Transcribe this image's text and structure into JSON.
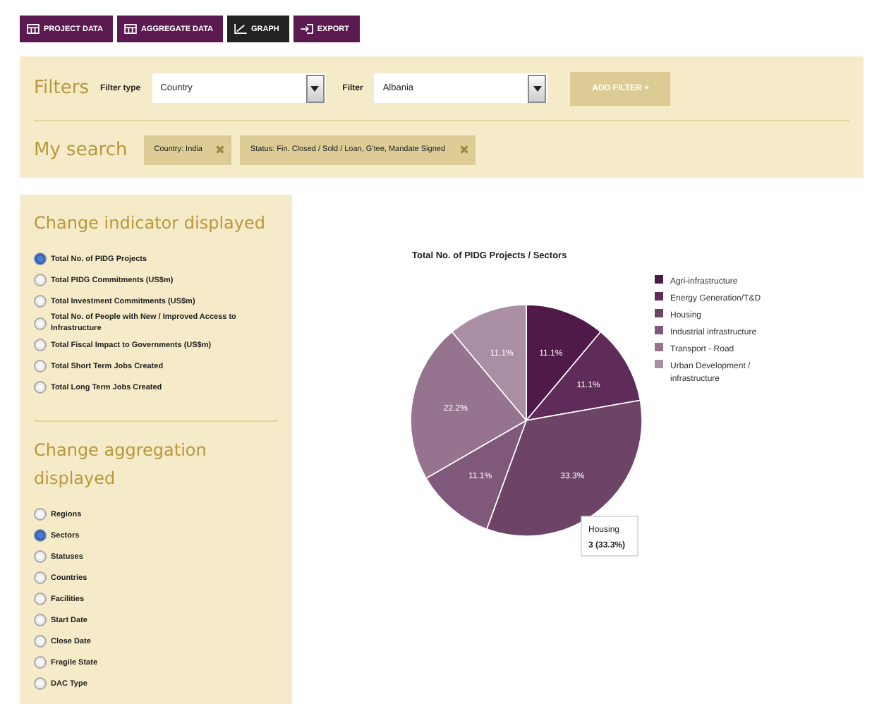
{
  "tabs": [
    {
      "label": "PROJECT DATA",
      "kind": "table",
      "selected": false
    },
    {
      "label": "AGGREGATE DATA",
      "kind": "table",
      "selected": false
    },
    {
      "label": "GRAPH",
      "kind": "chart",
      "selected": true
    },
    {
      "label": "EXPORT",
      "kind": "export",
      "selected": false
    }
  ],
  "filters": {
    "title": "Filters",
    "filter_type_label": "Filter type",
    "filter_type_value": "Country",
    "filter_label": "Filter",
    "filter_value": "Albania",
    "add_button": "ADD FILTER +"
  },
  "my_search": {
    "title": "My search",
    "tags": [
      {
        "label": "Country: India"
      },
      {
        "label": "Status: Fin. Closed / Sold / Loan, G'tee, Mandate Signed"
      }
    ]
  },
  "indicator": {
    "title": "Change indicator displayed",
    "options": [
      {
        "label": "Total No. of PIDG Projects",
        "selected": true
      },
      {
        "label": "Total PIDG Commitments (US$m)",
        "selected": false
      },
      {
        "label": "Total Investment Commitments (US$m)",
        "selected": false
      },
      {
        "label": "Total No. of People with New / Improved Access to Infrastructure",
        "selected": false
      },
      {
        "label": "Total Fiscal Impact to Governments (US$m)",
        "selected": false
      },
      {
        "label": "Total Short Term Jobs Created",
        "selected": false
      },
      {
        "label": "Total Long Term Jobs Created",
        "selected": false
      }
    ]
  },
  "aggregation": {
    "title": "Change aggregation displayed",
    "options": [
      {
        "label": "Regions",
        "selected": false
      },
      {
        "label": "Sectors",
        "selected": true
      },
      {
        "label": "Statuses",
        "selected": false
      },
      {
        "label": "Countries",
        "selected": false
      },
      {
        "label": "Facilities",
        "selected": false
      },
      {
        "label": "Start Date",
        "selected": false
      },
      {
        "label": "Close Date",
        "selected": false
      },
      {
        "label": "Fragile State",
        "selected": false
      },
      {
        "label": "DAC Type",
        "selected": false
      }
    ]
  },
  "chart_data": {
    "type": "pie",
    "title": "Total No. of PIDG Projects / Sectors",
    "categories": [
      "Agri-infrastructure",
      "Energy Generation/T&D",
      "Housing",
      "Industrial infrastructure",
      "Transport - Road",
      "Urban Development / infrastructure"
    ],
    "series": [
      {
        "values": [
          11.1,
          11.1,
          33.3,
          11.1,
          22.2,
          11.1
        ]
      }
    ],
    "colors": [
      "#4f1a48",
      "#5f2b58",
      "#6d4468",
      "#80587b",
      "#96748f",
      "#a98ea4"
    ],
    "value_labels": [
      "11.1%",
      "11.1%",
      "33.3%",
      "11.1%",
      "22.2%",
      "11.1%"
    ],
    "legend": true
  },
  "tooltip": {
    "title": "Housing",
    "value": "3 (33.3%)"
  }
}
